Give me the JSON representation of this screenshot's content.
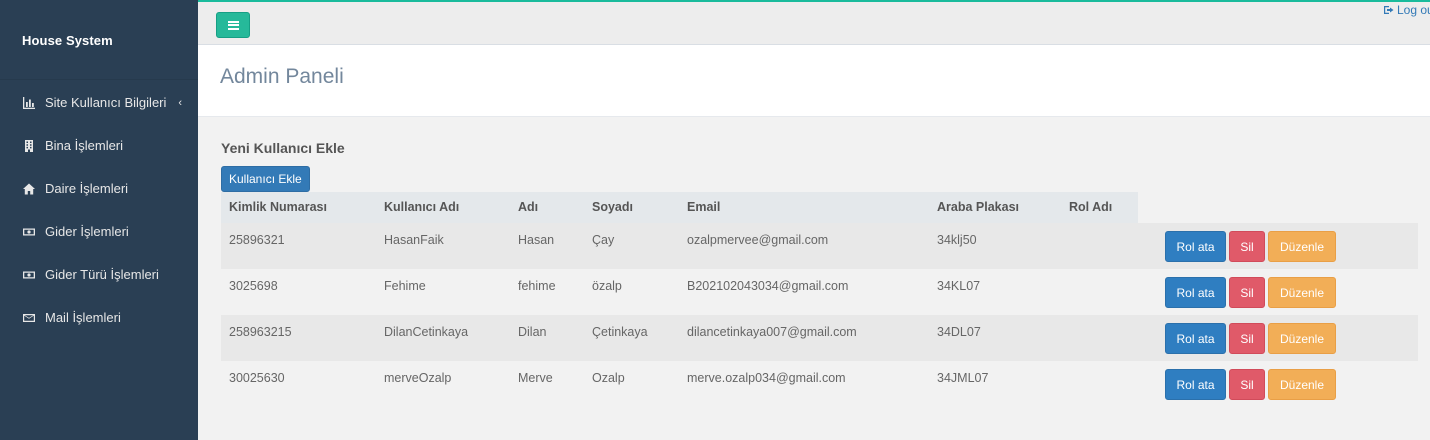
{
  "app": {
    "brand": "House System"
  },
  "sidebar": {
    "items": [
      {
        "label": "Site Kullanıcı Bilgileri",
        "icon": "bar-chart-icon",
        "has_caret": true
      },
      {
        "label": "Bina İşlemleri",
        "icon": "building-icon"
      },
      {
        "label": "Daire İşlemleri",
        "icon": "home-icon"
      },
      {
        "label": "Gider İşlemleri",
        "icon": "money-icon"
      },
      {
        "label": "Gider Türü İşlemleri",
        "icon": "money-icon"
      },
      {
        "label": "Mail İşlemleri",
        "icon": "envelope-icon"
      }
    ],
    "caret": "‹"
  },
  "topbar": {
    "logout_label": "Log out"
  },
  "page": {
    "title": "Admin Paneli"
  },
  "main": {
    "section_title": "Yeni Kullanıcı Ekle",
    "add_button": "Kullanıcı Ekle",
    "columns": [
      "Kimlik Numarası",
      "Kullanıcı Adı",
      "Adı",
      "Soyadı",
      "Email",
      "Araba Plakası",
      "Rol Adı"
    ],
    "rows": [
      {
        "id": "25896321",
        "username": "HasanFaik",
        "name": "Hasan",
        "surname": "Çay",
        "email": "ozalpmervee@gmail.com",
        "plate": "34klj50",
        "role": ""
      },
      {
        "id": "3025698",
        "username": "Fehime",
        "name": "fehime",
        "surname": "özalp",
        "email": "B202102043034@gmail.com",
        "plate": "34KL07",
        "role": ""
      },
      {
        "id": "258963215",
        "username": "DilanCetinkaya",
        "name": "Dilan",
        "surname": "Çetinkaya",
        "email": "dilancetinkaya007@gmail.com",
        "plate": "34DL07",
        "role": ""
      },
      {
        "id": "30025630",
        "username": "merveOzalp",
        "name": "Merve",
        "surname": "Ozalp",
        "email": "merve.ozalp034@gmail.com",
        "plate": "34JML07",
        "role": ""
      }
    ],
    "actions": {
      "assign_role": "Rol ata",
      "delete": "Sil",
      "edit": "Düzenle"
    }
  },
  "colors": {
    "sidebar_bg": "#2a3f54",
    "accent": "#26b99a",
    "primary": "#337ab7",
    "danger": "#e05a69",
    "warning": "#f2ae57"
  }
}
